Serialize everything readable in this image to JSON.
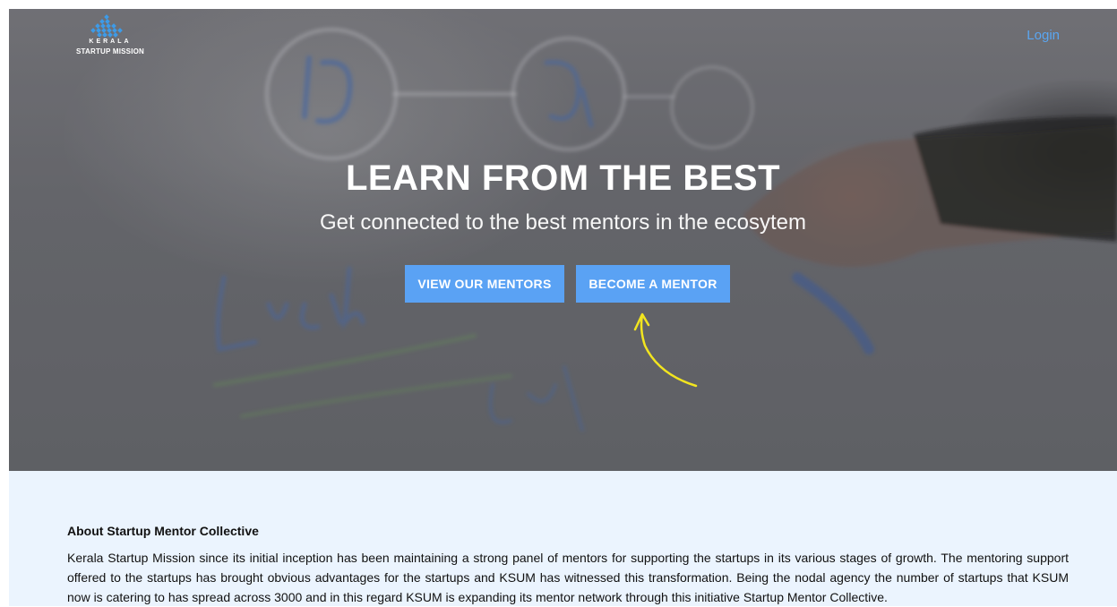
{
  "header": {
    "logo_top": "KERALA",
    "logo_bottom": "STARTUP MISSION",
    "login_label": "Login"
  },
  "hero": {
    "title": "LEARN FROM THE BEST",
    "subtitle": "Get connected to the best mentors in the ecosytem",
    "view_mentors_label": "VIEW OUR MENTORS",
    "become_mentor_label": "BECOME A MENTOR"
  },
  "about": {
    "title": "About Startup Mentor Collective",
    "body": "Kerala Startup Mission since its initial inception has been maintaining a strong panel of mentors for supporting the startups in its various stages of growth. The mentoring support offered to the startups has brought obvious advantages for the startups and KSUM has witnessed this transformation. Being the nodal agency the number of startups that KSUM now is catering to has spread across 3000 and in this regard KSUM is expanding its mentor network through this initiative Startup Mentor Collective."
  },
  "colors": {
    "accent": "#5aa2f4",
    "login": "#5aa6f2",
    "arrow": "#f2e51f",
    "about_bg": "#ebf4fe"
  },
  "icons": {
    "logo": "ksum-logo-icon",
    "arrow": "hand-drawn-arrow-icon"
  }
}
